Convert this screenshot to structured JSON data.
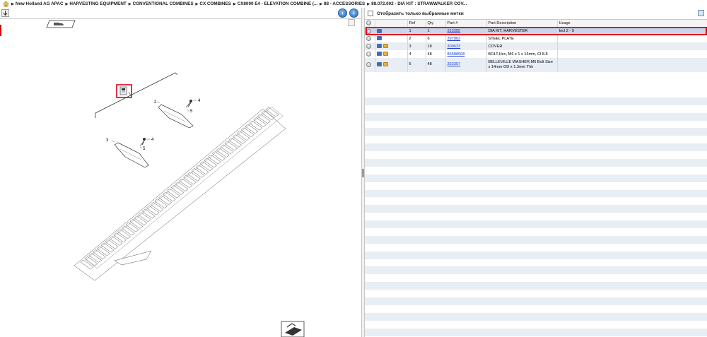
{
  "breadcrumb": {
    "items": [
      "New Holland AG APAC",
      "HARVESTING EQUIPMENT",
      "CONVENTIONAL COMBINES",
      "CX COMBINES",
      "CX8090 E4 - ELEVATION COMBINE (...",
      "88 - ACCESSORIES",
      "88.072.002 - DIA KIT : STRAWWALKER COV..."
    ]
  },
  "drawing": {
    "callouts": [
      "2",
      "4",
      "5",
      "3",
      "4",
      "5"
    ]
  },
  "filter": {
    "label": "Отобразить только выбранные метки"
  },
  "table": {
    "headers": [
      "Ref",
      "Qty",
      "Part #",
      "Part Description",
      "Usage"
    ],
    "rows": [
      {
        "ref": "1",
        "qty": "1",
        "part": "316385",
        "desc": "DIA KIT, HARVESTER",
        "usage": "Incl 2 - 5",
        "box": false
      },
      {
        "ref": "2",
        "qty": "6",
        "part": "397862",
        "desc": "STEEL PLATE",
        "usage": "",
        "box": false
      },
      {
        "ref": "3",
        "qty": "18",
        "part": "309623",
        "desc": "COVER",
        "usage": "",
        "box": true
      },
      {
        "ref": "4",
        "qty": "48",
        "part": "86588568",
        "desc": "BOLT,Hex, M6 x 1 x 16mm, Cl 8.8",
        "usage": "",
        "box": true
      },
      {
        "ref": "5",
        "qty": "48",
        "part": "322357",
        "desc": "BELLEVILLE WASHER,M6 Bolt Size x 14mm OD x 1.3mm Thk",
        "usage": "",
        "box": true
      }
    ]
  },
  "colors": {
    "accent": "#2a6fc0",
    "selection": "#e0001a",
    "link": "#1a3fd0"
  }
}
